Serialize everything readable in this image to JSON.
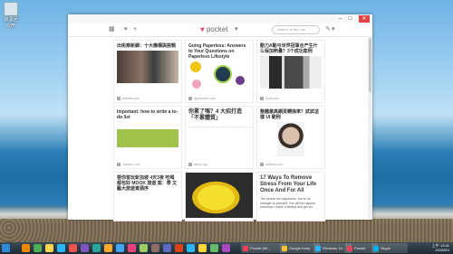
{
  "desktop": {
    "icon_label": "資源回收筒"
  },
  "window": {
    "controls": {
      "minimize": "–",
      "maximize": "□",
      "close": "✕"
    }
  },
  "toolbar": {
    "logo_text": "pocket",
    "search_placeholder": "Search in My List",
    "add_symbol": "+",
    "chevron": "▾"
  },
  "cards": [
    {
      "title": "出街乘新網：十大機構與挑戰",
      "source": "thestan.com"
    },
    {
      "title": "Going Paperless: Answers to Your Questions on Paperless Lifestyle",
      "source": "lightworker.com"
    },
    {
      "title": "動力A動与世界冠軍合产生什么保加熱量？3个成功案例",
      "source": "2sub.com"
    },
    {
      "title": "Important: how to write a to-do list",
      "source": "icelearn.com"
    },
    {
      "title": "你累了嗎？4 大招打造「不累體質」",
      "source": "storm.mg"
    },
    {
      "title": "整體最高網頁轉換率？試試這 樣 UI 範例",
      "source": "wildbud.com"
    },
    {
      "title": "替你客玩新加坡 4天3夜 吃喝都包好 MOOK 旅遊 案：學 文藝大旅遊資源序",
      "excerpt": ""
    },
    {
      "title": "",
      "source": ""
    },
    {
      "title": "17 Ways To Remove Stress From Your Life Once And For All",
      "excerpt": "The search for happiness. You're no stranger to yourself. You will be happier tomorrow. Leave it behind and get on."
    }
  ],
  "taskbar": {
    "windows": [
      {
        "label": "Pocket (Mi..."
      },
      {
        "label": "Google Keep"
      },
      {
        "label": "Windows 10..."
      },
      {
        "label": "Pocket"
      },
      {
        "label": "Skype"
      }
    ],
    "clock": {
      "time": "上午 12:41",
      "date": "2015/6/4"
    }
  }
}
